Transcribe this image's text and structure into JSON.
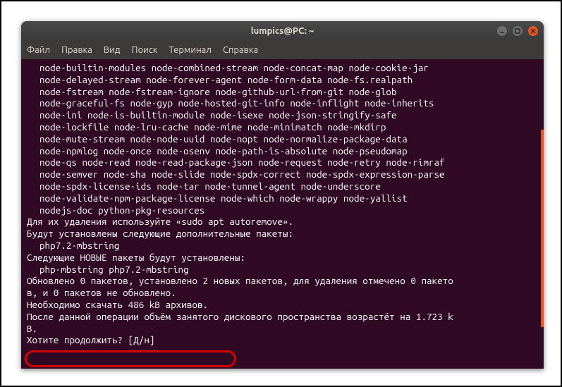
{
  "window": {
    "title": "lumpics@PC: ~"
  },
  "menubar": {
    "items": [
      "Файл",
      "Правка",
      "Вид",
      "Поиск",
      "Терминал",
      "Справка"
    ]
  },
  "terminal": {
    "lines": [
      {
        "indent": true,
        "text": "node-builtin-modules node-combined-stream node-concat-map node-cookie-jar"
      },
      {
        "indent": true,
        "text": "node-delayed-stream node-forever-agent node-form-data node-fs.realpath"
      },
      {
        "indent": true,
        "text": "node-fstream node-fstream-ignore node-github-url-from-git node-glob"
      },
      {
        "indent": true,
        "text": "node-graceful-fs node-gyp node-hosted-git-info node-inflight node-inherits"
      },
      {
        "indent": true,
        "text": "node-ini node-is-builtin-module node-isexe node-json-stringify-safe"
      },
      {
        "indent": true,
        "text": "node-lockfile node-lru-cache node-mime node-minimatch node-mkdirp"
      },
      {
        "indent": true,
        "text": "node-mute-stream node-node-uuid node-nopt node-normalize-package-data"
      },
      {
        "indent": true,
        "text": "node-npmlog node-once node-osenv node-path-is-absolute node-pseudomap"
      },
      {
        "indent": true,
        "text": "node-qs node-read node-read-package-json node-request node-retry node-rimraf"
      },
      {
        "indent": true,
        "text": "node-semver node-sha node-slide node-spdx-correct node-spdx-expression-parse"
      },
      {
        "indent": true,
        "text": "node-spdx-license-ids node-tar node-tunnel-agent node-underscore"
      },
      {
        "indent": true,
        "text": "node-validate-npm-package-license node-which node-wrappy node-yallist"
      },
      {
        "indent": true,
        "text": "nodejs-doc python-pkg-resources"
      },
      {
        "indent": false,
        "text": "Для их удаления используйте «sudo apt autoremove»."
      },
      {
        "indent": false,
        "text": "Будут установлены следующие дополнительные пакеты:"
      },
      {
        "indent": true,
        "text": "php7.2-mbstring"
      },
      {
        "indent": false,
        "text": "Следующие НОВЫЕ пакеты будут установлены:"
      },
      {
        "indent": true,
        "text": "php-mbstring php7.2-mbstring"
      },
      {
        "indent": false,
        "text": "Обновлено 0 пакетов, установлено 2 новых пакетов, для удаления отмечено 0 пакето"
      },
      {
        "indent": false,
        "text": "в, и 0 пакетов не обновлено."
      },
      {
        "indent": false,
        "text": "Необходимо скачать 486 kB архивов."
      },
      {
        "indent": false,
        "text": "После данной операции объём занятого дискового пространства возрастёт на 1.723 k"
      },
      {
        "indent": false,
        "text": "B."
      },
      {
        "indent": false,
        "text": "Хотите продолжить? [Д/н]"
      }
    ]
  }
}
